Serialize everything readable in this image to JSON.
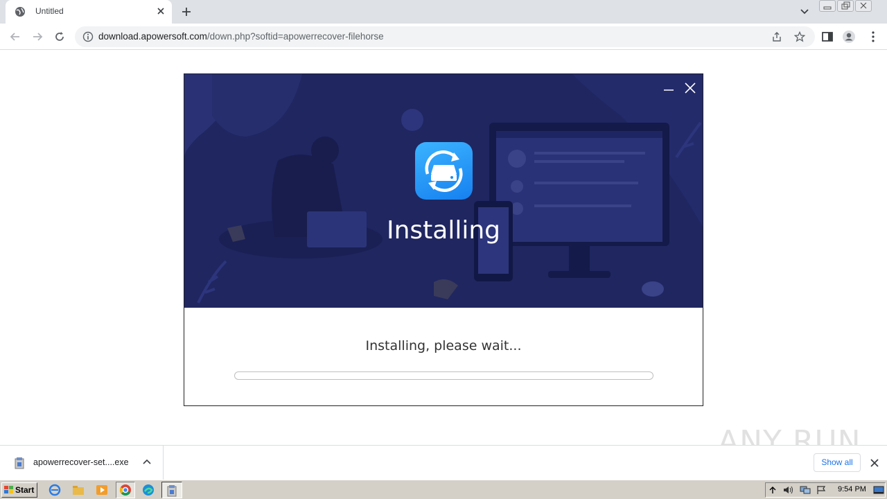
{
  "browser": {
    "tab_title": "Untitled",
    "url_domain": "download.apowersoft.com",
    "url_path": "/down.php?softid=apowerrecover-filehorse"
  },
  "installer": {
    "heading": "Installing",
    "status_text": "Installing, please wait...",
    "progress_percent": 0,
    "accent_color": "#2d8cf0",
    "hero_bg_color": "#1f2660"
  },
  "download_shelf": {
    "file_name": "apowerrecover-set....exe",
    "show_all_label": "Show all"
  },
  "watermark": "ANY RUN",
  "taskbar": {
    "start_label": "Start",
    "clock": "9:54 PM"
  }
}
